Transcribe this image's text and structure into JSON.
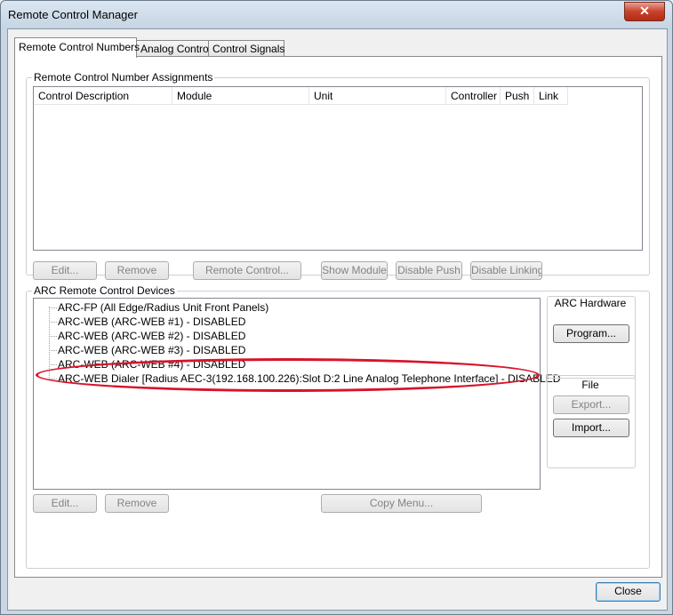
{
  "window": {
    "title": "Remote Control Manager",
    "close_glyph": "✕"
  },
  "tabs": [
    {
      "label": "Remote Control Numbers"
    },
    {
      "label": "Analog Control"
    },
    {
      "label": "Control Signals"
    }
  ],
  "assignments": {
    "group_label": "Remote Control Number Assignments",
    "columns": [
      "Control Description",
      "Module",
      "Unit",
      "Controller",
      "Push",
      "Link"
    ],
    "buttons": {
      "edit": "Edit...",
      "remove": "Remove",
      "remote_control": "Remote Control...",
      "show_module": "Show Module",
      "disable_push": "Disable Push",
      "disable_linking": "Disable Linking"
    }
  },
  "devices": {
    "group_label": "ARC Remote Control Devices",
    "items": [
      "ARC-FP (All Edge/Radius Unit Front Panels)",
      "ARC-WEB (ARC-WEB #1) - DISABLED",
      "ARC-WEB (ARC-WEB #2) - DISABLED",
      "ARC-WEB (ARC-WEB #3) - DISABLED",
      "ARC-WEB (ARC-WEB #4) - DISABLED",
      "ARC-WEB Dialer [Radius AEC-3(192.168.100.226):Slot D:2 Line Analog Telephone Interface] - DISABLED"
    ],
    "buttons": {
      "edit": "Edit...",
      "remove": "Remove",
      "copy_menu": "Copy Menu..."
    },
    "hardware": {
      "title": "ARC Hardware",
      "program": "Program..."
    },
    "file": {
      "title": "File",
      "export": "Export...",
      "import": "Import..."
    }
  },
  "footer": {
    "close": "Close"
  },
  "colors": {
    "highlight_ellipse": "#d8132a"
  }
}
